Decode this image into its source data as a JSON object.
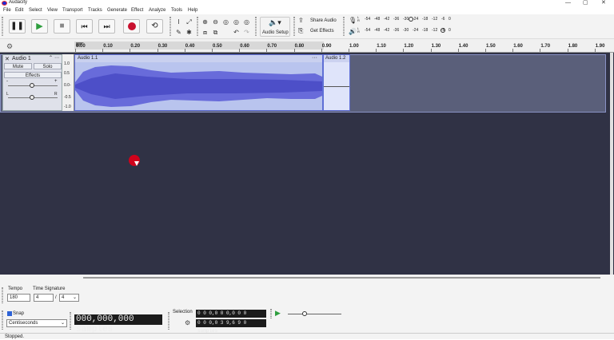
{
  "window": {
    "title": "Audacity",
    "min": "—",
    "max": "▢",
    "close": "✕"
  },
  "menu": [
    "File",
    "Edit",
    "Select",
    "View",
    "Transport",
    "Tracks",
    "Generate",
    "Effect",
    "Analyze",
    "Tools",
    "Help"
  ],
  "toolbar": {
    "audio_setup": "Audio Setup",
    "share_audio": "Share Audio",
    "get_effects": "Get Effects",
    "meter_ticks": [
      "-54",
      "-48",
      "-42",
      "-36",
      "-30",
      "-24",
      "-18",
      "-12",
      "-6",
      "0"
    ],
    "meter_l": "L",
    "meter_r": "R",
    "meter_lr": "L\nR"
  },
  "ruler": {
    "ticks": [
      "0.00",
      "0.10",
      "0.20",
      "0.30",
      "0.40",
      "0.50",
      "0.60",
      "0.70",
      "0.80",
      "0.90",
      "1.00",
      "1.10",
      "1.20",
      "1.30",
      "1.40",
      "1.50",
      "1.60",
      "1.70",
      "1.80",
      "1.90"
    ]
  },
  "track": {
    "name": "Audio 1",
    "mute": "Mute",
    "solo": "Solo",
    "effects": "Effects",
    "gain_minus": "-",
    "gain_plus": "+",
    "pan_l": "L",
    "pan_r": "R",
    "scale": [
      "1.0",
      "0.5",
      "0.0-",
      "-0.5",
      "-1.0"
    ],
    "clips": [
      {
        "name": "Audio 1.1",
        "menu": "···"
      },
      {
        "name": "Audio 1.2"
      }
    ]
  },
  "bottom": {
    "tempo_label": "Tempo",
    "tempo_value": "180",
    "timesig_label": "Time Signature",
    "timesig_num": "4",
    "timesig_slash": "/",
    "timesig_den": "4",
    "snap_label": "Snap",
    "snap_unit": "Centiseconds",
    "time_display": "000,000,000 samples",
    "selection_label": "Selection",
    "selection_start": "0 0 0,0 0 0,0 0 0 samples",
    "selection_end": "0 0 0,0 3 9,6 9 0 samples"
  },
  "status": {
    "text": "Stopped."
  },
  "colors": {
    "record": "#c8102e",
    "waveform": "#5b5ed6",
    "track_bg": "#303245",
    "play": "#2e9e3e"
  }
}
